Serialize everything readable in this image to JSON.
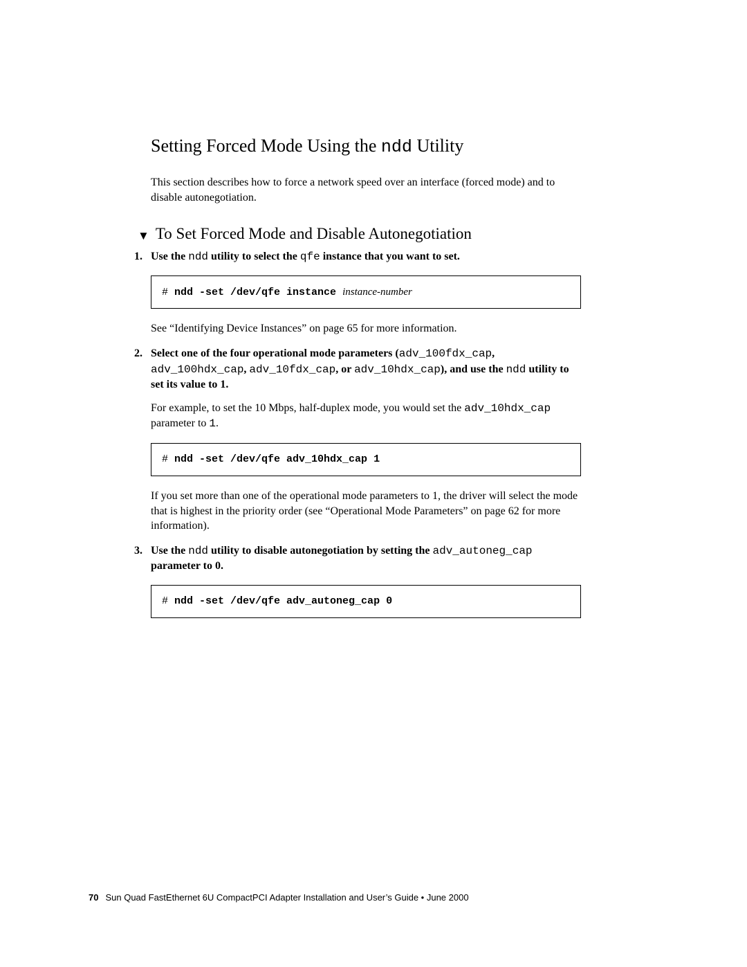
{
  "heading": {
    "pre": "Setting Forced Mode Using the ",
    "mono": "ndd",
    "post": " Utility"
  },
  "intro": "This section describes how to force a network speed over an interface (forced mode) and to disable autonegotiation.",
  "procedure_title": "To Set Forced Mode and Disable Autonegotiation",
  "step1": {
    "t1": "Use the ",
    "m1": "ndd",
    "t2": " utility to select the ",
    "m2": "qfe",
    "t3": " instance that you want to set."
  },
  "code1": {
    "prompt": "# ",
    "bold": "ndd -set /dev/qfe instance ",
    "italic": "instance-number"
  },
  "after_code1": "See “Identifying Device Instances” on page 65 for more information.",
  "step2": {
    "t1": "Select one of the four operational mode parameters (",
    "m1": "adv_100fdx_cap",
    "t2": ", ",
    "m2": "adv_100hdx_cap",
    "t3": ", ",
    "m3": "adv_10fdx_cap",
    "t4": ", or ",
    "m4": "adv_10hdx_cap",
    "t5": "), and use the ",
    "m5": "ndd",
    "t6": " utility to set its value to 1."
  },
  "after_step2_a": {
    "t1": "For example, to set the 10 Mbps, half-duplex mode, you would set the ",
    "m1": "adv_10hdx_cap",
    "t2": " parameter to ",
    "m2": "1",
    "t3": "."
  },
  "code2": {
    "prompt": "# ",
    "bold": "ndd -set /dev/qfe adv_10hdx_cap 1"
  },
  "after_code2": "If you set more than one of the operational mode parameters to 1, the driver will select the mode that is highest in the priority order (see “Operational Mode Parameters” on page 62 for more information).",
  "step3": {
    "t1": "Use the ",
    "m1": "ndd",
    "t2": " utility to disable autonegotiation by setting the ",
    "m2": "adv_autoneg_cap",
    "t3": " parameter to 0."
  },
  "code3": {
    "prompt": "# ",
    "bold": "ndd -set /dev/qfe adv_autoneg_cap 0"
  },
  "footer": {
    "page_number": "70",
    "text": "Sun Quad FastEthernet 6U CompactPCI Adapter Installation and User’s Guide • June 2000"
  }
}
